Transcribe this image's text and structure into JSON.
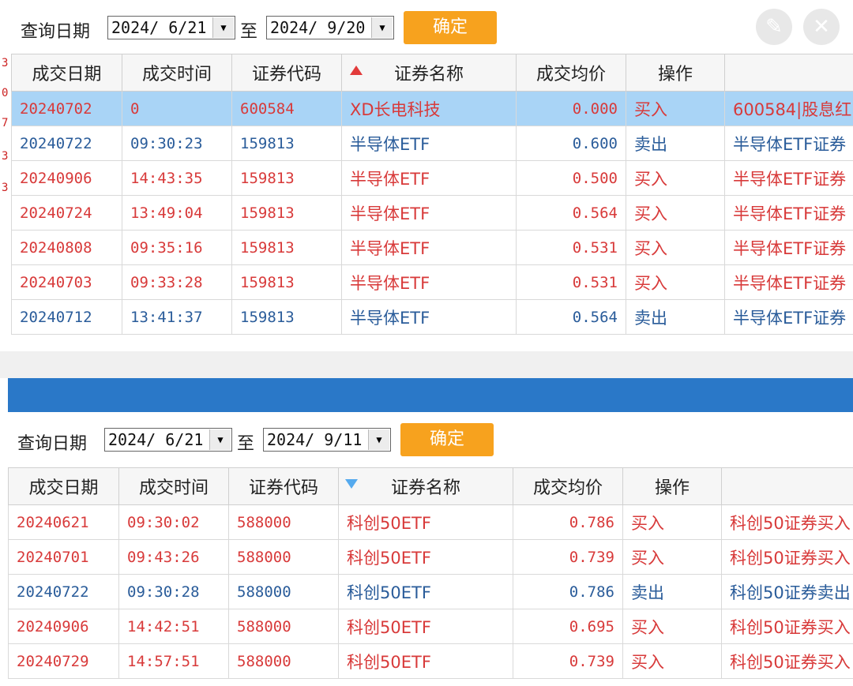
{
  "top": {
    "query": {
      "label": "查询日期",
      "start_date": "2024/ 6/21",
      "to_label": "至",
      "end_date": "2024/ 9/20",
      "confirm_label": "确定"
    },
    "edit_icon": "✎",
    "close_icon": "✕",
    "left_edge_chars": [
      "3",
      "0",
      "7",
      "3",
      "3"
    ],
    "columns": [
      "成交日期",
      "成交时间",
      "证券代码",
      "证券名称",
      "成交均价",
      "操作",
      ""
    ],
    "sort_column": "证券名称",
    "sort_direction": "ascending",
    "rows": [
      {
        "date": "20240702",
        "time": "0",
        "code": "600584",
        "name": "XD长电科技",
        "price": "0.000",
        "op": "买入",
        "note": "600584|股息红",
        "color": "red",
        "selected": true
      },
      {
        "date": "20240722",
        "time": "09:30:23",
        "code": "159813",
        "name": "半导体ETF",
        "price": "0.600",
        "op": "卖出",
        "note": "半导体ETF证券",
        "color": "blue",
        "selected": false
      },
      {
        "date": "20240906",
        "time": "14:43:35",
        "code": "159813",
        "name": "半导体ETF",
        "price": "0.500",
        "op": "买入",
        "note": "半导体ETF证券",
        "color": "red",
        "selected": false
      },
      {
        "date": "20240724",
        "time": "13:49:04",
        "code": "159813",
        "name": "半导体ETF",
        "price": "0.564",
        "op": "买入",
        "note": "半导体ETF证券",
        "color": "red",
        "selected": false
      },
      {
        "date": "20240808",
        "time": "09:35:16",
        "code": "159813",
        "name": "半导体ETF",
        "price": "0.531",
        "op": "买入",
        "note": "半导体ETF证券",
        "color": "red",
        "selected": false
      },
      {
        "date": "20240703",
        "time": "09:33:28",
        "code": "159813",
        "name": "半导体ETF",
        "price": "0.531",
        "op": "买入",
        "note": "半导体ETF证券",
        "color": "red",
        "selected": false
      },
      {
        "date": "20240712",
        "time": "13:41:37",
        "code": "159813",
        "name": "半导体ETF",
        "price": "0.564",
        "op": "卖出",
        "note": "半导体ETF证券",
        "color": "blue",
        "selected": false
      }
    ]
  },
  "bottom": {
    "query": {
      "label": "查询日期",
      "start_date": "2024/ 6/21",
      "to_label": "至",
      "end_date": "2024/ 9/11",
      "confirm_label": "确定"
    },
    "columns": [
      "成交日期",
      "成交时间",
      "证券代码",
      "证券名称",
      "成交均价",
      "操作",
      ""
    ],
    "sort_column": "证券名称",
    "sort_direction": "descending",
    "rows": [
      {
        "date": "20240621",
        "time": "09:30:02",
        "code": "588000",
        "name": "科创50ETF",
        "price": "0.786",
        "op": "买入",
        "note": "科创50证券买入",
        "color": "red"
      },
      {
        "date": "20240701",
        "time": "09:43:26",
        "code": "588000",
        "name": "科创50ETF",
        "price": "0.739",
        "op": "买入",
        "note": "科创50证券买入",
        "color": "red"
      },
      {
        "date": "20240722",
        "time": "09:30:28",
        "code": "588000",
        "name": "科创50ETF",
        "price": "0.786",
        "op": "卖出",
        "note": "科创50证券卖出",
        "color": "blue"
      },
      {
        "date": "20240906",
        "time": "14:42:51",
        "code": "588000",
        "name": "科创50ETF",
        "price": "0.695",
        "op": "买入",
        "note": "科创50证券买入",
        "color": "red"
      },
      {
        "date": "20240729",
        "time": "14:57:51",
        "code": "588000",
        "name": "科创50ETF",
        "price": "0.739",
        "op": "买入",
        "note": "科创50证券买入",
        "color": "red"
      }
    ]
  },
  "colors": {
    "buy": "#d83a3a",
    "sell": "#2a5c9a",
    "selected_row": "#a9d4f6",
    "confirm_button": "#f7a21e",
    "divider": "#2a78c8"
  }
}
